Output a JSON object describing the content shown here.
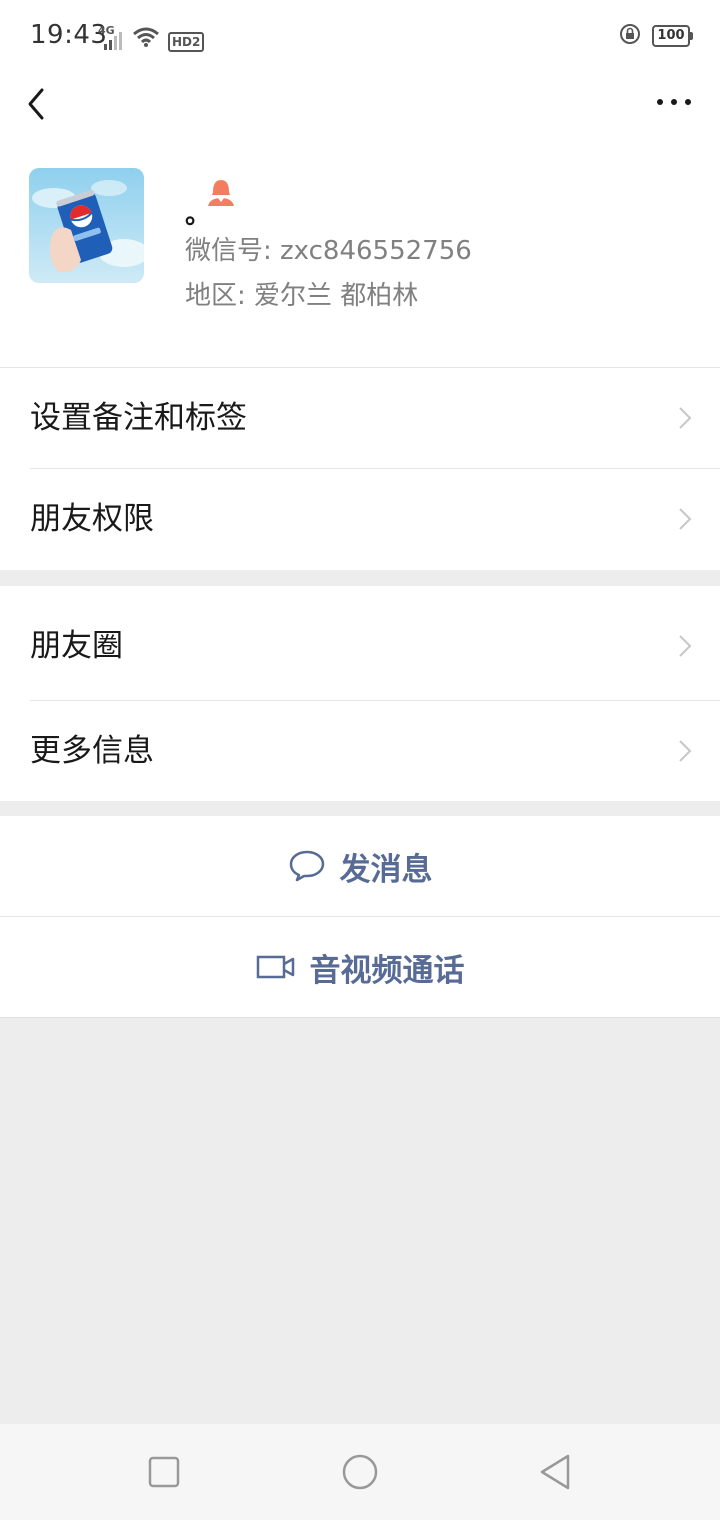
{
  "status_bar": {
    "time": "19:43",
    "network": "4G",
    "hd": "HD2",
    "battery": "100"
  },
  "nav": {
    "back_icon": "chevron-left-icon",
    "more_icon": "more-dots-icon"
  },
  "profile": {
    "nickname": "。",
    "gender_icon": "female-icon",
    "wechat_id": "微信号: zxc846552756",
    "region": "地区: 爱尔兰  都柏林"
  },
  "menu_group_1": [
    {
      "label": "设置备注和标签"
    },
    {
      "label": "朋友权限"
    }
  ],
  "menu_group_2": [
    {
      "label": "朋友圈"
    },
    {
      "label": "更多信息"
    }
  ],
  "actions": {
    "send_message": "发消息",
    "video_call": "音视频通话"
  },
  "colors": {
    "link": "#576b95",
    "background": "#ededed",
    "gender_female": "#f37e5f"
  }
}
